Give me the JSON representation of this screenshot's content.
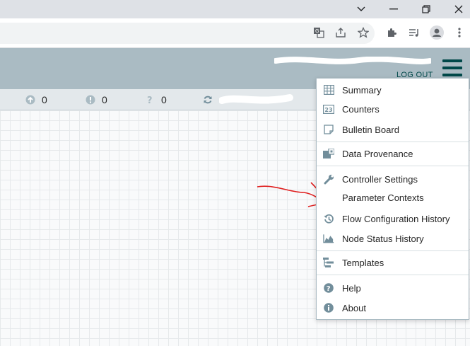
{
  "status": {
    "up_to_date": "0",
    "locally_modified": "0",
    "sync_failure": "0"
  },
  "header": {
    "logout_label": "LOG OUT"
  },
  "menu": {
    "items": [
      {
        "label": "Summary",
        "icon": "table-icon"
      },
      {
        "label": "Counters",
        "icon": "counters-icon"
      },
      {
        "label": "Bulletin Board",
        "icon": "note-icon"
      },
      {
        "label": "Data Provenance",
        "icon": "provenance-icon"
      },
      {
        "label": "Controller Settings",
        "icon": "wrench-icon"
      },
      {
        "label": "Parameter Contexts",
        "icon": ""
      },
      {
        "label": "Flow Configuration History",
        "icon": "history-icon"
      },
      {
        "label": "Node Status History",
        "icon": "area-chart-icon"
      },
      {
        "label": "Templates",
        "icon": "templates-icon"
      },
      {
        "label": "Help",
        "icon": "help-icon"
      },
      {
        "label": "About",
        "icon": "info-icon"
      }
    ]
  },
  "colors": {
    "accent": "#004849",
    "header_bg": "#aabbc3",
    "icon": "#728e9b"
  }
}
